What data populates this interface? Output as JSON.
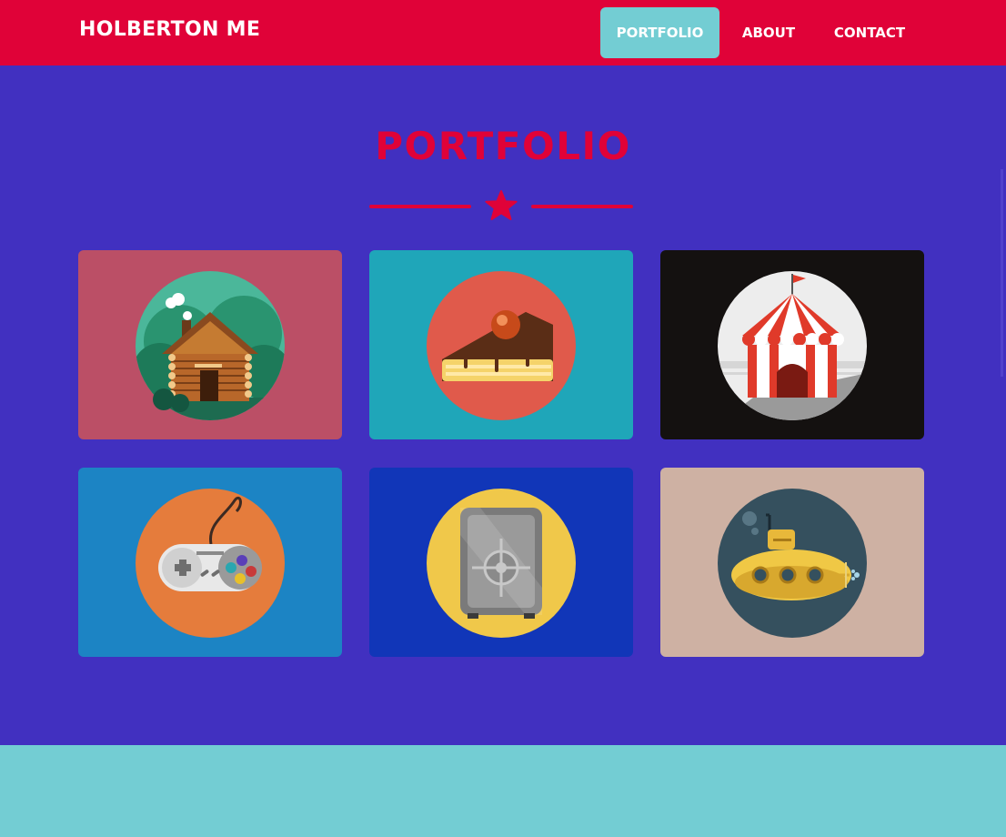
{
  "nav": {
    "brand": "HOLBERTON ME",
    "links": [
      "PORTFOLIO",
      "ABOUT",
      "CONTACT"
    ],
    "active_link": "PORTFOLIO"
  },
  "portfolio": {
    "heading": "PORTFOLIO",
    "divider_icon": "star-icon",
    "items": [
      {
        "icon": "log-cabin-icon",
        "background": "#bb4f66"
      },
      {
        "icon": "cake-slice-icon",
        "background": "#1fa6b9"
      },
      {
        "icon": "circus-tent-icon",
        "background": "#141110"
      },
      {
        "icon": "game-controller-icon",
        "background": "#1c84c4"
      },
      {
        "icon": "safe-icon",
        "background": "#1136b8"
      },
      {
        "icon": "submarine-icon",
        "background": "#ceb1a3"
      }
    ]
  },
  "colors": {
    "primary_red": "#e00238",
    "background_purple": "#4130c0",
    "accent_teal": "#73cdd3"
  }
}
